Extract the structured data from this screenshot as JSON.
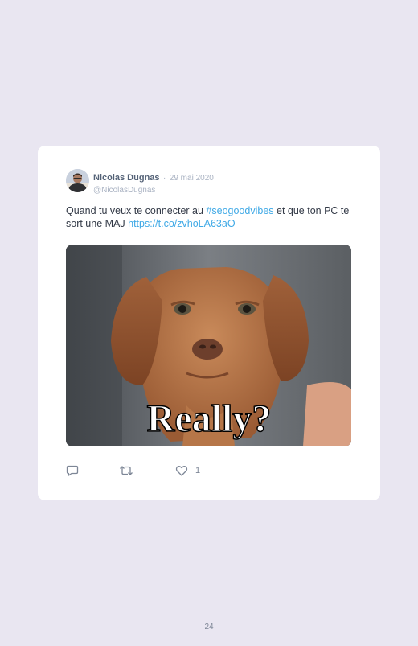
{
  "tweet": {
    "display_name": "Nicolas Dugnas",
    "separator": "·",
    "date": "29 mai 2020",
    "handle": "@NicolasDugnas",
    "text_part1": "Quand tu veux te connecter au ",
    "hashtag": "#seogoodvibes",
    "text_part2": " et que ton PC te sort une MAJ ",
    "link": "https://t.co/zvhoLA63aO",
    "media_caption": "Really?",
    "like_count": "1"
  },
  "icons": {
    "reply": "reply-icon",
    "retweet": "retweet-icon",
    "like": "heart-icon"
  },
  "colors": {
    "background": "#e9e6f1",
    "card": "#ffffff",
    "link": "#3fa9e6",
    "name": "#546277",
    "muted": "#a9b2c2"
  },
  "page": {
    "number": "24"
  }
}
